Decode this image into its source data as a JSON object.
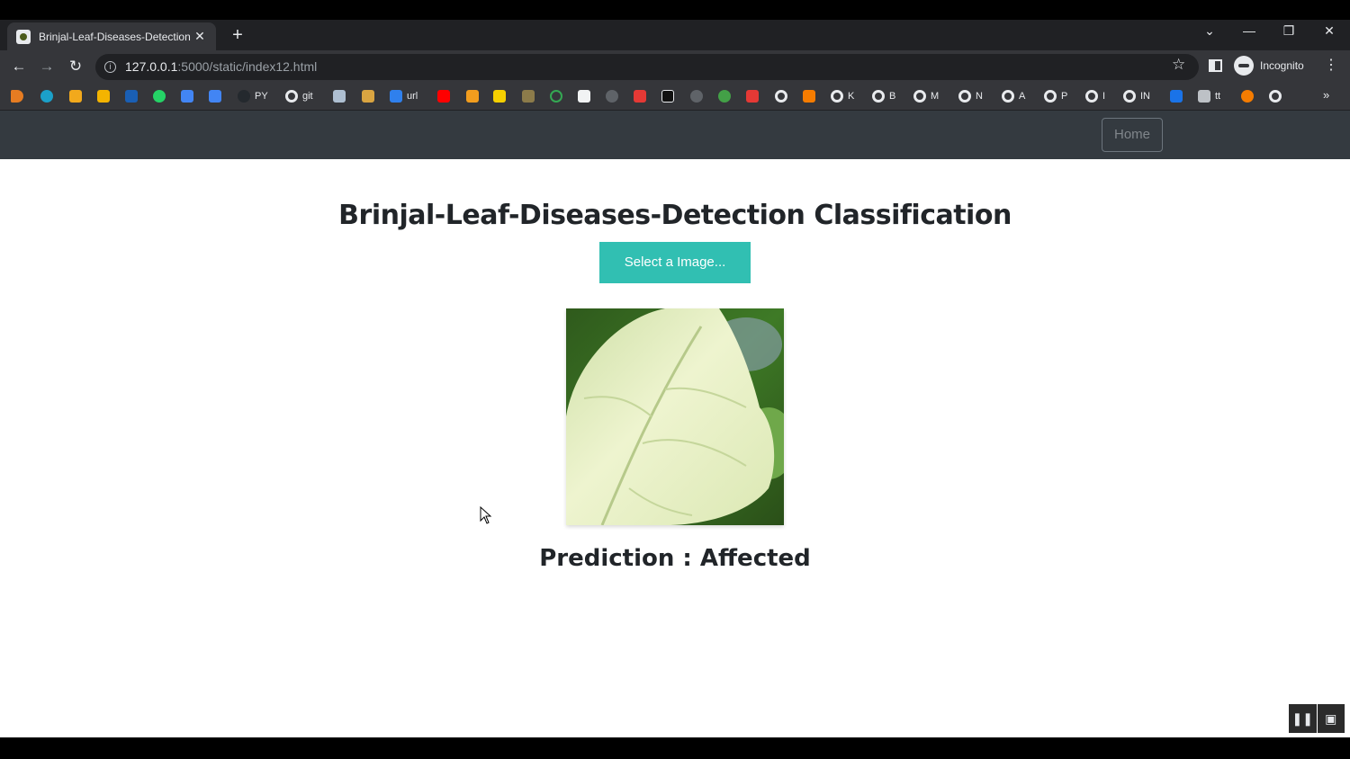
{
  "browser": {
    "tab_title": "Brinjal-Leaf-Diseases-Detection",
    "tab_close": "✕",
    "new_tab": "+",
    "url_host": "127.0.0.1",
    "url_path": ":5000/static/index12.html",
    "profile_label": "Incognito",
    "bookmarks": [
      "PY",
      "git",
      "url",
      "K",
      "B",
      "M",
      "N",
      "A",
      "P",
      "I",
      "IN",
      "tt"
    ]
  },
  "navbar": {
    "home_label": "Home"
  },
  "main": {
    "heading": "Brinjal-Leaf-Diseases-Detection Classification",
    "select_button_label": "Select a Image...",
    "prediction_label": "Prediction : ",
    "prediction_value": "Affected"
  },
  "colors": {
    "accent": "#31bfb2",
    "navbar": "#343a40"
  }
}
